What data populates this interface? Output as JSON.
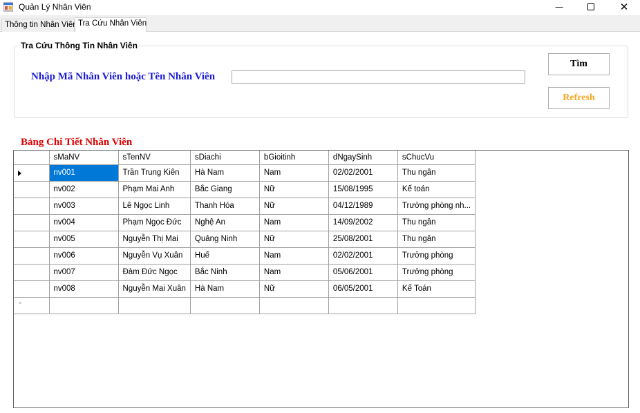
{
  "window": {
    "title": "Quản Lý Nhân Viên"
  },
  "tabs": [
    {
      "label": "Thông tin Nhân Viên"
    },
    {
      "label": "Tra Cứu Nhân Viên"
    }
  ],
  "search_group": {
    "title": "Tra Cứu Thông Tin Nhân Viên",
    "label": "Nhập Mã Nhân Viên hoặc Tên Nhân Viên",
    "input_value": "",
    "find_label": "Tìm",
    "refresh_label": "Refresh"
  },
  "grid": {
    "title": "Bảng Chi Tiết Nhân Viên",
    "columns": [
      "sMaNV",
      "sTenNV",
      "sDiachi",
      "bGioitinh",
      "dNgaySinh",
      "sChucVu"
    ],
    "rows": [
      [
        "nv001",
        "Trần Trung Kiên",
        "Hà Nam",
        "Nam",
        "02/02/2001",
        "Thu ngân"
      ],
      [
        "nv002",
        "Phạm Mai Anh",
        "Bắc Giang",
        "Nữ",
        "15/08/1995",
        "Kế toán"
      ],
      [
        "nv003",
        "Lê Ngọc Linh",
        "Thanh Hóa",
        "Nữ",
        "04/12/1989",
        "Trưởng phòng nh..."
      ],
      [
        "nv004",
        "Phạm Ngọc Đức",
        "Nghệ An",
        "Nam",
        "14/09/2002",
        "Thu ngân"
      ],
      [
        "nv005",
        "Nguyễn Thị Mai",
        "Quảng Ninh",
        "Nữ",
        "25/08/2001",
        "Thu ngân"
      ],
      [
        "nv006",
        "Nguyễn Vụ Xuân",
        "Huế",
        "Nam",
        "02/02/2001",
        "Trưởng phòng"
      ],
      [
        "nv007",
        "Đàm Đức Ngọc",
        "Bắc Ninh",
        "Nam",
        "05/06/2001",
        "Trưởng phòng"
      ],
      [
        "nv008",
        "Nguyễn Mai Xuân",
        "Hà Nam",
        "Nữ",
        "06/05/2001",
        "Kế Toán"
      ]
    ],
    "selected_row": 0
  },
  "colors": {
    "search_label": "#1a1ad6",
    "grid_title": "#e00000",
    "refresh_text": "#f5a623",
    "selection": "#0078d7"
  },
  "icons": [
    "app-icon",
    "minimize-icon",
    "maximize-icon",
    "close-icon",
    "current-row-arrow-icon",
    "new-row-icon"
  ]
}
